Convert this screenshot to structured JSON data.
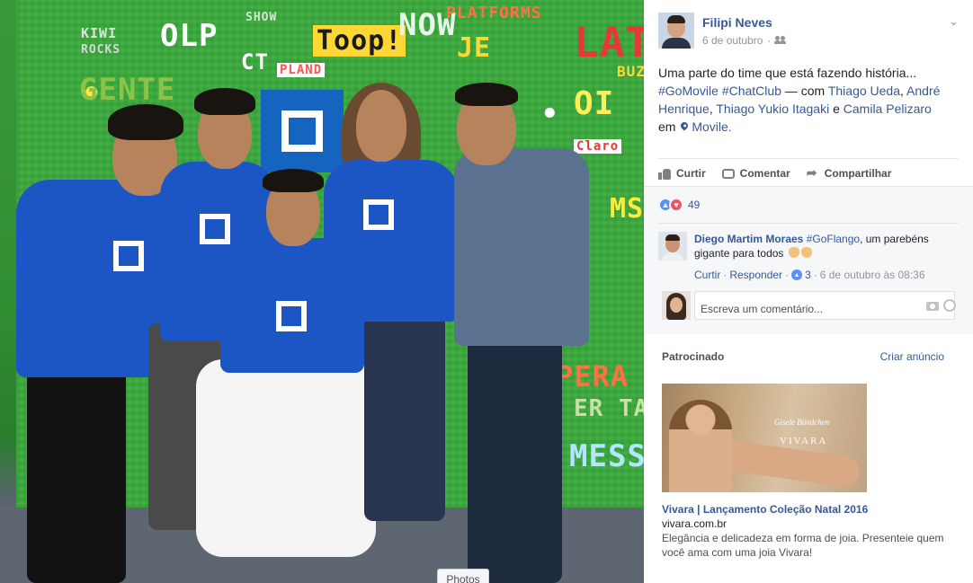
{
  "photo": {
    "alt": "",
    "tab_label": "Photos",
    "wall_words": [
      "KIWI",
      "ROCKS",
      "OLP",
      "SHOW",
      "Toop!",
      "NOW",
      "PLATFORMS",
      "JE",
      "LAT",
      "GENTE",
      "CT",
      "PLAND",
      "BUZ",
      "Claro",
      "OI",
      "MS",
      "PERA",
      "ER TA",
      "MESS"
    ]
  },
  "post": {
    "author": "Filipi Neves",
    "date": "6 de outubro",
    "privacy_icon": "friends-icon",
    "text_intro": "Uma parte do time que está fazendo história...",
    "hashtags": [
      "#GoMovile",
      "#ChatClub"
    ],
    "with_prefix": " — com ",
    "tagged": [
      "Thiago Ueda",
      "André Henrique",
      "Thiago Yukio Itagaki",
      "Camila Pelizaro"
    ],
    "sep_comma": ", ",
    "sep_and": " e ",
    "at_prefix": "em",
    "location": "Movile.",
    "options_icon": "chevron-down-icon"
  },
  "actions": {
    "like": "Curtir",
    "comment": "Comentar",
    "share": "Compartilhar"
  },
  "reactions": {
    "count": "49"
  },
  "comment": {
    "author": "Diego Martim Moraes",
    "hashtag": "#GoFlango",
    "text": ", um parebéns gigante para todos",
    "like_link": "Curtir",
    "reply_link": "Responder",
    "like_count": "3",
    "sep": "·",
    "timestamp": "6 de outubro às 08:36"
  },
  "composer": {
    "placeholder": "Escreva um comentário..."
  },
  "ad": {
    "header": "Patrocinado",
    "create": "Criar anúncio",
    "image_signature": "Gisele Bündchen",
    "image_brand": "VIVARA",
    "title": "Vivara | Lançamento Coleção Natal 2016",
    "domain": "vivara.com.br",
    "description": "Elegância e delicadeza em forma de joia. Presenteie quem você ama com uma joia Vivara!"
  },
  "colors": {
    "link": "#365899",
    "shirt_blue": "#1c55c4",
    "wall_green": "#39a83b",
    "like_blue": "#5890ff",
    "love_red": "#f25268"
  }
}
